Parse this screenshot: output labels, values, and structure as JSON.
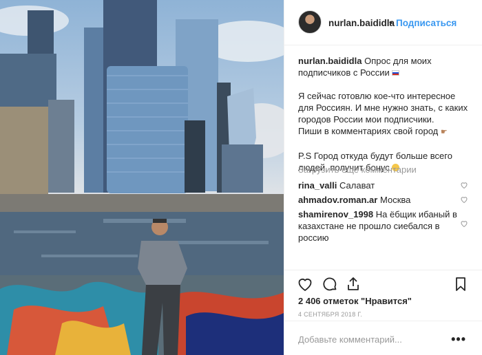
{
  "post": {
    "username": "nurlan.baididla",
    "follow_label": "Подписаться",
    "dot": "•",
    "caption": {
      "username": "nurlan.baididla",
      "line1": "Опрос для моих подписчиков с России",
      "para1": "Я сейчас готовлю кое-что интересное для Россиян. И мне нужно знать, с каких городов России мои подписчики.",
      "para2": "Пиши в комментариях свой город",
      "para3": "P.S Город откуда будут больше всего людей, получит бонус"
    },
    "load_more": "Загрузить еще комментарии",
    "comments": [
      {
        "username": "rina_valli",
        "text": "Салават"
      },
      {
        "username": "ahmadov.roman.ar",
        "text": "Москва"
      },
      {
        "username": "shamirenov_1998",
        "text": "На ёбщик ибаный в казахстане не прошло сиебался в россию"
      }
    ],
    "likes": "2 406 отметок \"Нравится\"",
    "date": "4 сентября 2018 г.",
    "add_comment_placeholder": "Добавьте комментарий...",
    "more_menu": "•••"
  },
  "icons": {
    "like": "heart-icon",
    "comment": "comment-bubble-icon",
    "share": "share-icon",
    "save": "bookmark-icon",
    "comment_like": "heart-outline-icon"
  },
  "colors": {
    "link": "#3897f0",
    "text": "#262626",
    "muted": "#999999",
    "border": "#efefef"
  }
}
